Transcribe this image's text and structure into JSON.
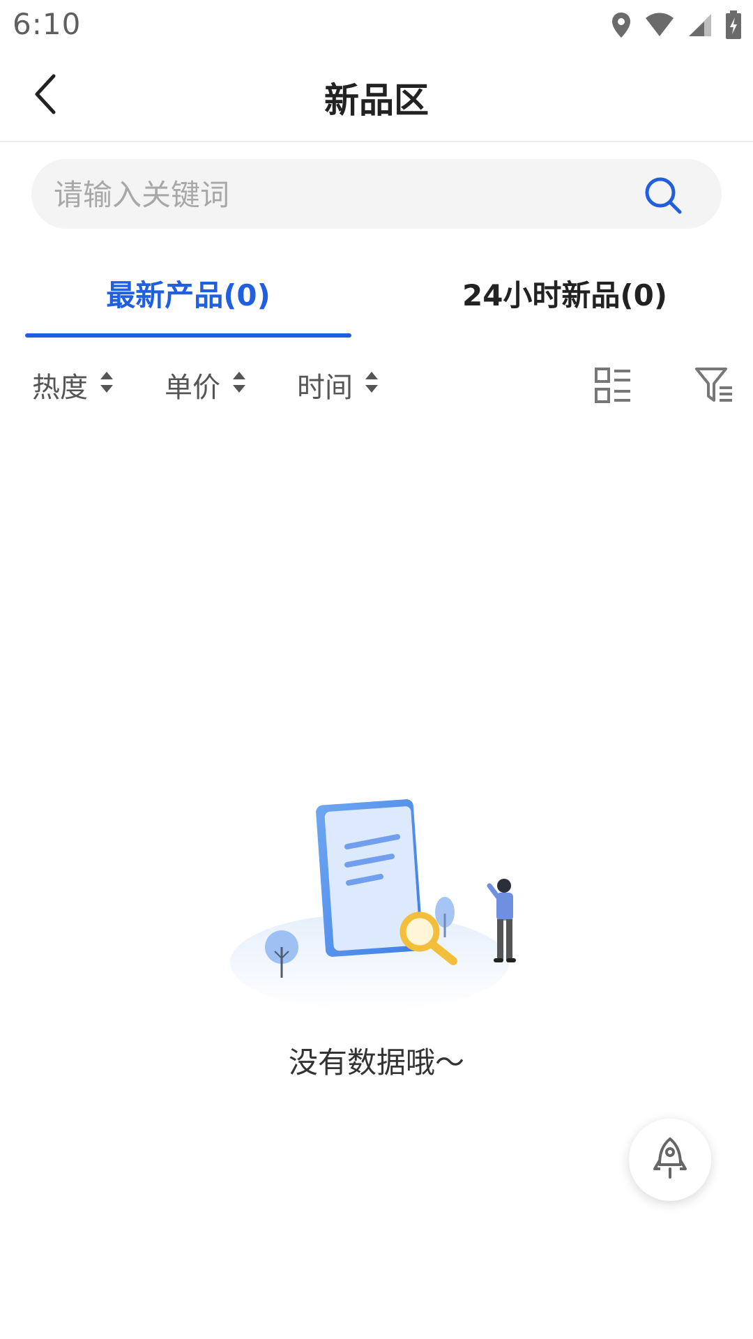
{
  "status_bar": {
    "time": "6:10",
    "icons": [
      "location-icon",
      "wifi-icon",
      "signal-icon",
      "battery-charging-icon"
    ]
  },
  "nav": {
    "title": "新品区",
    "back_icon": "chevron-left-icon"
  },
  "search": {
    "placeholder": "请输入关键词",
    "value": "",
    "icon": "search-icon"
  },
  "tabs": [
    {
      "label": "最新产品(0)",
      "active": true
    },
    {
      "label": "24小时新品(0)",
      "active": false
    }
  ],
  "sort": {
    "items": [
      {
        "label": "热度",
        "icon": "sort-arrows-icon"
      },
      {
        "label": "单价",
        "icon": "sort-arrows-icon"
      },
      {
        "label": "时间",
        "icon": "sort-arrows-icon"
      }
    ],
    "layout_icon": "list-layout-icon",
    "filter_icon": "filter-icon"
  },
  "empty_state": {
    "message": "没有数据哦～",
    "illustration": "empty-search-illustration"
  },
  "floating_button": {
    "icon": "rocket-icon"
  },
  "colors": {
    "accent": "#1f5fe0",
    "text": "#222222",
    "muted": "#a8a8a8",
    "search_bg": "#f4f4f4"
  }
}
